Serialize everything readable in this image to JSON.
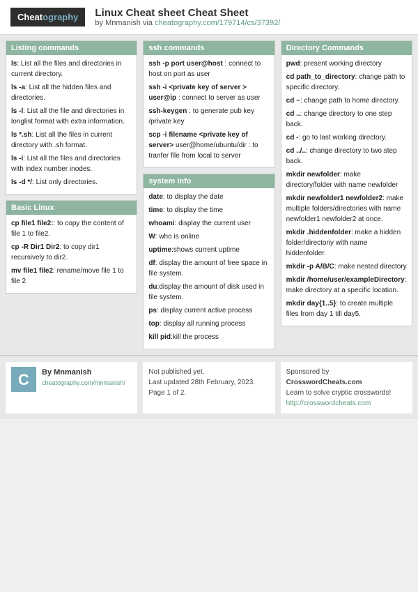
{
  "header": {
    "logo_text": "Cheatography",
    "title": "Linux Cheat sheet Cheat Sheet",
    "by_label": "by",
    "author": "Mnmanish",
    "via_label": "via",
    "url": "cheatography.com/179714/cs/37392/"
  },
  "sections": [
    {
      "id": "listing",
      "header": "Listing commands",
      "items": [
        {
          "cmd": "ls",
          "desc": ": List all the files and directories in current directory."
        },
        {
          "cmd": "ls -a",
          "desc": ": List all the hidden files and directories."
        },
        {
          "cmd": "ls -l",
          "desc": ": List all the file and directories in longlist format with extra information."
        },
        {
          "cmd": "ls *.sh",
          "desc": ": List all the files in current directory with .sh format."
        },
        {
          "cmd": "ls -i",
          "desc": ": List all the files and directories with index number inodes."
        },
        {
          "cmd": "ls -d */",
          "desc": ": List only directories."
        }
      ]
    },
    {
      "id": "ssh",
      "header": "ssh commands",
      "items": [
        {
          "cmd": "ssh -p port user@host",
          "desc": ": connect to host on port as user"
        },
        {
          "cmd": "ssh -i <private key of server > user@ip",
          "desc": ": connect to server as user"
        },
        {
          "cmd": "ssh-keygen",
          "desc": ": to generate pub key /private key"
        },
        {
          "cmd": "scp -i filename <private key of server>",
          "desc": " user@home/ubuntu/dir : to tranfer file from local to server"
        }
      ]
    },
    {
      "id": "directory",
      "header": "Directory Commands",
      "items": [
        {
          "cmd": "pwd",
          "desc": ": present working directory"
        },
        {
          "cmd": "cd path_to_directory",
          "desc": ": change path to specific directory."
        },
        {
          "cmd": "cd ~",
          "desc": ": change path to home directory."
        },
        {
          "cmd": "cd ..",
          "desc": ": change directory to one step back."
        },
        {
          "cmd": "cd -",
          "desc": ": go to last working directory."
        },
        {
          "cmd": "cd ../..",
          "desc": ": change directory to two step back."
        },
        {
          "cmd": "mkdir newfolder",
          "desc": ": make directory/folder with name newfolder"
        },
        {
          "cmd": "mkdir newfolder1 newfolder2",
          "desc": ": make multiple folders/directories with name newfolder1 newfolder2 at once."
        },
        {
          "cmd": "mkdir .hiddenfolder",
          "desc": ": make a hidden folder/directoriy with name hiddenfolder."
        },
        {
          "cmd": "mkdir -p A/B/C",
          "desc": ": make nested directory"
        },
        {
          "cmd": "mkdir /home/user/exampleDirectory",
          "desc": ": make directory at a specific location."
        },
        {
          "cmd": "mkdir day{1..5}",
          "desc": ": to create multiple files from day 1 till day5."
        }
      ]
    },
    {
      "id": "basic",
      "header": "Basic Linux",
      "items": [
        {
          "cmd": "cp file1 file2:",
          "desc": ": to copy the content of file 1 to file2."
        },
        {
          "cmd": "cp -R Dir1 Dir2",
          "desc": ": to copy dir1 recursively to dir2."
        },
        {
          "cmd": "mv file1 file2",
          "desc": ": rename/move file 1 to file 2"
        }
      ]
    },
    {
      "id": "sysinfo",
      "header": "system info",
      "items": [
        {
          "cmd": "date",
          "desc": ": to display the date"
        },
        {
          "cmd": "time",
          "desc": ": to display the time"
        },
        {
          "cmd": "whoami",
          "desc": ": display the current user"
        },
        {
          "cmd": "W",
          "desc": ": who is online"
        },
        {
          "cmd": "uptime",
          "desc": ":shows current uptime"
        },
        {
          "cmd": "df",
          "desc": ": display the amount of free space in file system."
        },
        {
          "cmd": "du",
          "desc": ":display the amount of disk used in file system."
        },
        {
          "cmd": "ps",
          "desc": ": display current active process"
        },
        {
          "cmd": "top",
          "desc": ": display all running process"
        },
        {
          "cmd": "kill pid",
          "desc": ":kill the process"
        }
      ]
    }
  ],
  "footer": {
    "c_letter": "C",
    "author_name": "By Mnmanish",
    "author_url": "cheatography.com/mnmanish/",
    "publish_status": "Not published yet.",
    "last_updated": "Last updated 28th February, 2023.",
    "page": "Page 1 of 2.",
    "sponsor_label": "Sponsored by",
    "sponsor_name": "CrosswordCheats.com",
    "sponsor_desc": "Learn to solve cryptic crosswords!",
    "sponsor_url": "http://crosswordcheats.com"
  }
}
